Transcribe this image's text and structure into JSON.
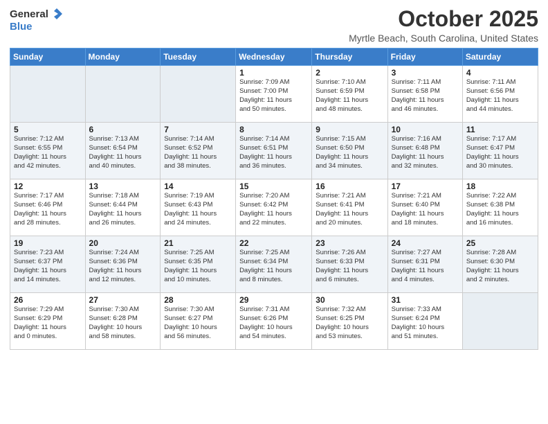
{
  "header": {
    "logo_general": "General",
    "logo_blue": "Blue",
    "month": "October 2025",
    "location": "Myrtle Beach, South Carolina, United States"
  },
  "weekdays": [
    "Sunday",
    "Monday",
    "Tuesday",
    "Wednesday",
    "Thursday",
    "Friday",
    "Saturday"
  ],
  "weeks": [
    [
      {
        "day": "",
        "info": ""
      },
      {
        "day": "",
        "info": ""
      },
      {
        "day": "",
        "info": ""
      },
      {
        "day": "1",
        "info": "Sunrise: 7:09 AM\nSunset: 7:00 PM\nDaylight: 11 hours\nand 50 minutes."
      },
      {
        "day": "2",
        "info": "Sunrise: 7:10 AM\nSunset: 6:59 PM\nDaylight: 11 hours\nand 48 minutes."
      },
      {
        "day": "3",
        "info": "Sunrise: 7:11 AM\nSunset: 6:58 PM\nDaylight: 11 hours\nand 46 minutes."
      },
      {
        "day": "4",
        "info": "Sunrise: 7:11 AM\nSunset: 6:56 PM\nDaylight: 11 hours\nand 44 minutes."
      }
    ],
    [
      {
        "day": "5",
        "info": "Sunrise: 7:12 AM\nSunset: 6:55 PM\nDaylight: 11 hours\nand 42 minutes."
      },
      {
        "day": "6",
        "info": "Sunrise: 7:13 AM\nSunset: 6:54 PM\nDaylight: 11 hours\nand 40 minutes."
      },
      {
        "day": "7",
        "info": "Sunrise: 7:14 AM\nSunset: 6:52 PM\nDaylight: 11 hours\nand 38 minutes."
      },
      {
        "day": "8",
        "info": "Sunrise: 7:14 AM\nSunset: 6:51 PM\nDaylight: 11 hours\nand 36 minutes."
      },
      {
        "day": "9",
        "info": "Sunrise: 7:15 AM\nSunset: 6:50 PM\nDaylight: 11 hours\nand 34 minutes."
      },
      {
        "day": "10",
        "info": "Sunrise: 7:16 AM\nSunset: 6:48 PM\nDaylight: 11 hours\nand 32 minutes."
      },
      {
        "day": "11",
        "info": "Sunrise: 7:17 AM\nSunset: 6:47 PM\nDaylight: 11 hours\nand 30 minutes."
      }
    ],
    [
      {
        "day": "12",
        "info": "Sunrise: 7:17 AM\nSunset: 6:46 PM\nDaylight: 11 hours\nand 28 minutes."
      },
      {
        "day": "13",
        "info": "Sunrise: 7:18 AM\nSunset: 6:44 PM\nDaylight: 11 hours\nand 26 minutes."
      },
      {
        "day": "14",
        "info": "Sunrise: 7:19 AM\nSunset: 6:43 PM\nDaylight: 11 hours\nand 24 minutes."
      },
      {
        "day": "15",
        "info": "Sunrise: 7:20 AM\nSunset: 6:42 PM\nDaylight: 11 hours\nand 22 minutes."
      },
      {
        "day": "16",
        "info": "Sunrise: 7:21 AM\nSunset: 6:41 PM\nDaylight: 11 hours\nand 20 minutes."
      },
      {
        "day": "17",
        "info": "Sunrise: 7:21 AM\nSunset: 6:40 PM\nDaylight: 11 hours\nand 18 minutes."
      },
      {
        "day": "18",
        "info": "Sunrise: 7:22 AM\nSunset: 6:38 PM\nDaylight: 11 hours\nand 16 minutes."
      }
    ],
    [
      {
        "day": "19",
        "info": "Sunrise: 7:23 AM\nSunset: 6:37 PM\nDaylight: 11 hours\nand 14 minutes."
      },
      {
        "day": "20",
        "info": "Sunrise: 7:24 AM\nSunset: 6:36 PM\nDaylight: 11 hours\nand 12 minutes."
      },
      {
        "day": "21",
        "info": "Sunrise: 7:25 AM\nSunset: 6:35 PM\nDaylight: 11 hours\nand 10 minutes."
      },
      {
        "day": "22",
        "info": "Sunrise: 7:25 AM\nSunset: 6:34 PM\nDaylight: 11 hours\nand 8 minutes."
      },
      {
        "day": "23",
        "info": "Sunrise: 7:26 AM\nSunset: 6:33 PM\nDaylight: 11 hours\nand 6 minutes."
      },
      {
        "day": "24",
        "info": "Sunrise: 7:27 AM\nSunset: 6:31 PM\nDaylight: 11 hours\nand 4 minutes."
      },
      {
        "day": "25",
        "info": "Sunrise: 7:28 AM\nSunset: 6:30 PM\nDaylight: 11 hours\nand 2 minutes."
      }
    ],
    [
      {
        "day": "26",
        "info": "Sunrise: 7:29 AM\nSunset: 6:29 PM\nDaylight: 11 hours\nand 0 minutes."
      },
      {
        "day": "27",
        "info": "Sunrise: 7:30 AM\nSunset: 6:28 PM\nDaylight: 10 hours\nand 58 minutes."
      },
      {
        "day": "28",
        "info": "Sunrise: 7:30 AM\nSunset: 6:27 PM\nDaylight: 10 hours\nand 56 minutes."
      },
      {
        "day": "29",
        "info": "Sunrise: 7:31 AM\nSunset: 6:26 PM\nDaylight: 10 hours\nand 54 minutes."
      },
      {
        "day": "30",
        "info": "Sunrise: 7:32 AM\nSunset: 6:25 PM\nDaylight: 10 hours\nand 53 minutes."
      },
      {
        "day": "31",
        "info": "Sunrise: 7:33 AM\nSunset: 6:24 PM\nDaylight: 10 hours\nand 51 minutes."
      },
      {
        "day": "",
        "info": ""
      }
    ]
  ]
}
